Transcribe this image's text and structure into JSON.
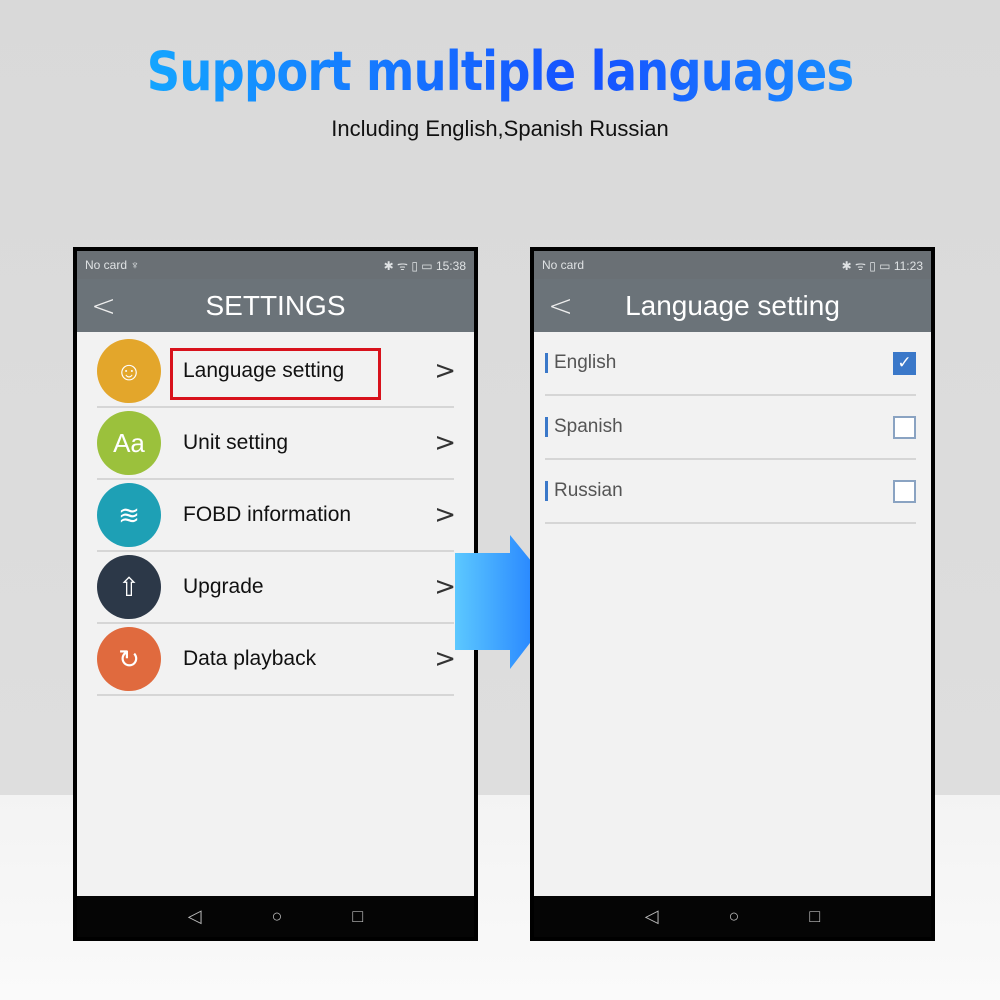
{
  "headline": "Support multiple languages",
  "subheadline": "Including English,Spanish Russian",
  "left_phone": {
    "status_left": "No card ♆",
    "status_right": "✱ ᯤ ▯ ▭ 15:38",
    "title": "SETTINGS",
    "items": [
      {
        "label": "Language setting",
        "icon": "speaking-head-icon",
        "color": "#e3a62b",
        "glyph": "☺",
        "highlighted": true
      },
      {
        "label": "Unit setting",
        "icon": "font-aa-icon",
        "color": "#9bc13c",
        "glyph": "Aa"
      },
      {
        "label": "FOBD information",
        "icon": "layers-icon",
        "color": "#1ea0b5",
        "glyph": "≋"
      },
      {
        "label": "Upgrade",
        "icon": "upload-icon",
        "color": "#2c3848",
        "glyph": "⇧"
      },
      {
        "label": "Data playback",
        "icon": "chart-refresh-icon",
        "color": "#e06a3e",
        "glyph": "↻"
      }
    ]
  },
  "right_phone": {
    "status_left": "No card",
    "status_right": "✱ ᯤ ▯ ▭ 11:23",
    "title": "Language setting",
    "languages": [
      {
        "label": "English",
        "checked": true
      },
      {
        "label": "Spanish",
        "checked": false
      },
      {
        "label": "Russian",
        "checked": false
      }
    ]
  },
  "nav": {
    "back": "◁",
    "home": "○",
    "recent": "□"
  },
  "accent_color": "#3a78c9",
  "highlight_color": "#d8121c"
}
